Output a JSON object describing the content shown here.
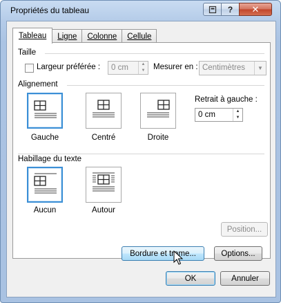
{
  "window": {
    "title": "Propriétés du tableau"
  },
  "titlebar": {
    "help_glyph": "⊡",
    "close_glyph": "✕"
  },
  "tabs": [
    {
      "label": "Tableau",
      "active": true
    },
    {
      "label": "Ligne",
      "active": false
    },
    {
      "label": "Colonne",
      "active": false
    },
    {
      "label": "Cellule",
      "active": false
    }
  ],
  "taille": {
    "group_title": "Taille",
    "preferred_width_label": "Largeur préférée :",
    "preferred_width_value": "0 cm",
    "measure_label": "Mesurer en :",
    "measure_value": "Centimètres"
  },
  "alignement": {
    "group_title": "Alignement",
    "options": [
      {
        "label": "Gauche",
        "selected": true,
        "icon": "align-left-icon"
      },
      {
        "label": "Centré",
        "selected": false,
        "icon": "align-center-icon"
      },
      {
        "label": "Droite",
        "selected": false,
        "icon": "align-right-icon"
      }
    ],
    "indent_label": "Retrait à gauche :",
    "indent_value": "0 cm"
  },
  "habillage": {
    "group_title": "Habillage du texte",
    "options": [
      {
        "label": "Aucun",
        "selected": true,
        "icon": "wrap-none-icon"
      },
      {
        "label": "Autour",
        "selected": false,
        "icon": "wrap-around-icon"
      }
    ],
    "position_button": "Position..."
  },
  "buttons": {
    "borders": "Bordure et trame...",
    "options": "Options...",
    "ok": "OK",
    "cancel": "Annuler"
  },
  "colors": {
    "selection_border": "#3b8fd6",
    "title_gradient": "#b4cbe8",
    "close_button": "#c1442a"
  }
}
